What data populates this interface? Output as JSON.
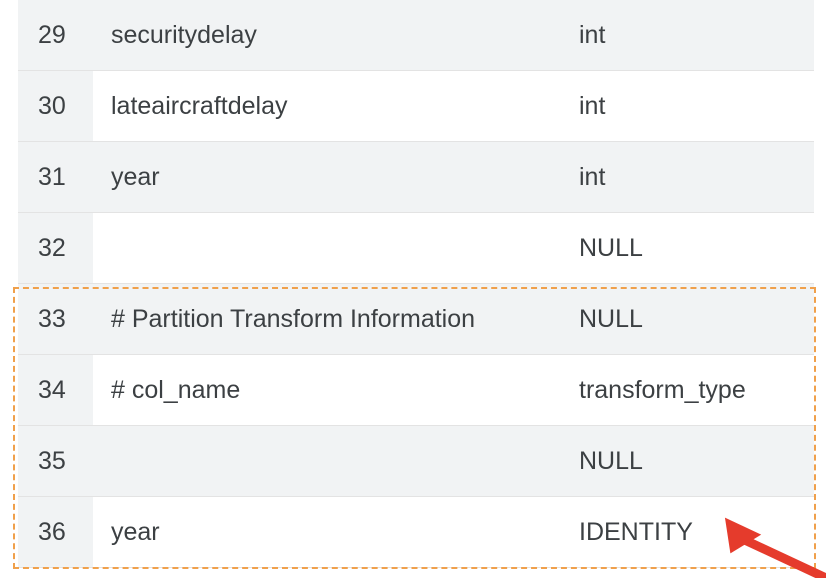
{
  "rows": [
    {
      "index": "29",
      "col_name": "securitydelay",
      "data_type": "int"
    },
    {
      "index": "30",
      "col_name": "lateaircraftdelay",
      "data_type": "int"
    },
    {
      "index": "31",
      "col_name": "year",
      "data_type": "int"
    },
    {
      "index": "32",
      "col_name": "",
      "data_type": "NULL"
    },
    {
      "index": "33",
      "col_name": "# Partition Transform Information",
      "data_type": "NULL"
    },
    {
      "index": "34",
      "col_name": "# col_name",
      "data_type": "transform_type"
    },
    {
      "index": "35",
      "col_name": "",
      "data_type": "NULL"
    },
    {
      "index": "36",
      "col_name": "year",
      "data_type": "IDENTITY"
    }
  ],
  "colors": {
    "row_gray": "#f1f3f4",
    "text": "#3c4043",
    "highlight_border": "#f0a04b",
    "arrow": "#e53b2c"
  }
}
